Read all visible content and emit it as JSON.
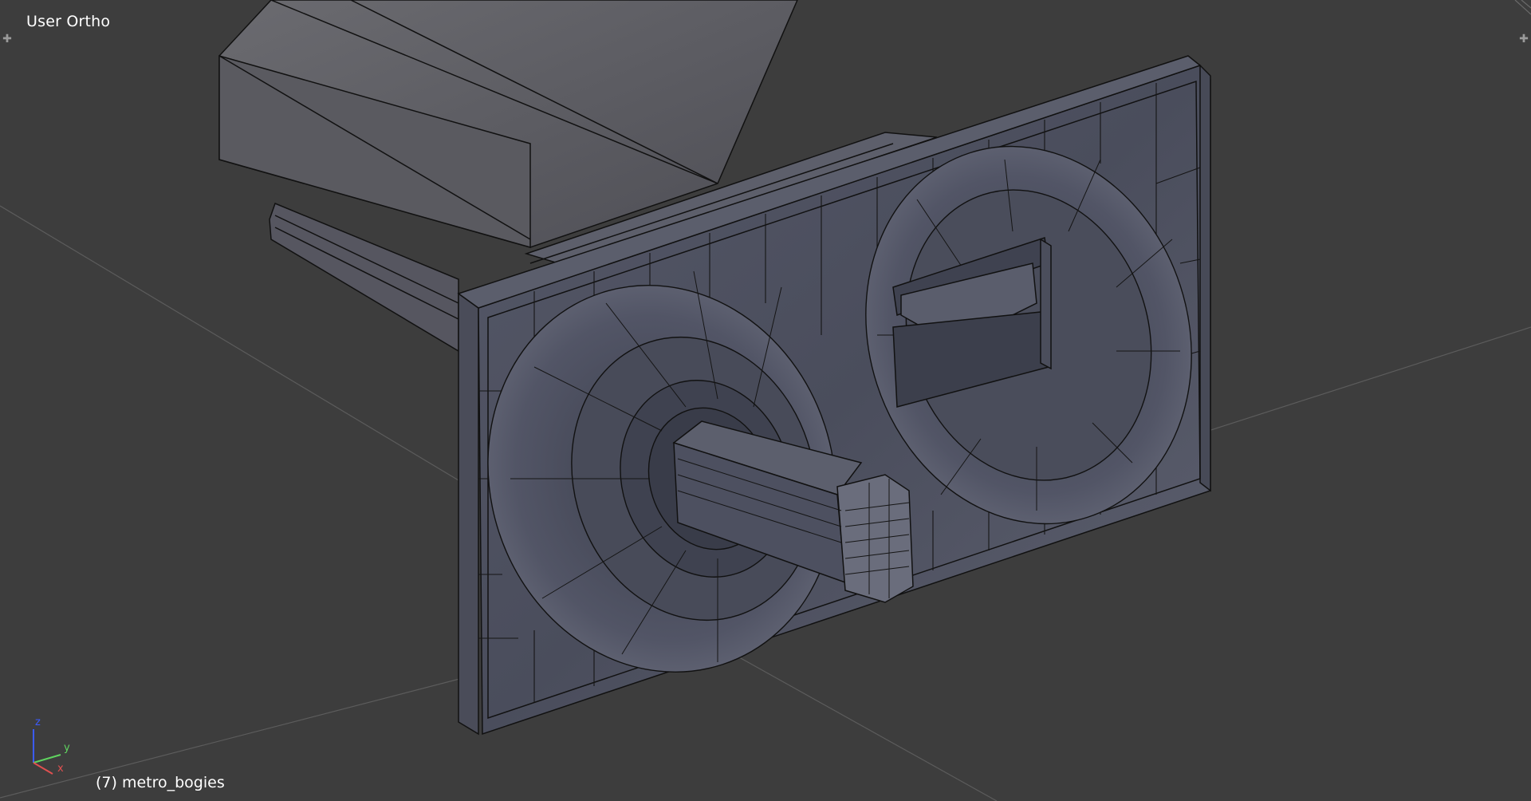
{
  "viewport": {
    "view_name": "User Ortho",
    "object_label": "(7) metro_bogies",
    "background_color": "#3d3d3d",
    "grid_color": "#5a5a5a",
    "mesh_face_color": "#4f5160",
    "mesh_wire_color": "#111111"
  },
  "corner_widgets": {
    "left_icon": "split-area-plus-icon",
    "left_glyph": "✚",
    "right_icon": "split-area-plus-icon",
    "right_glyph": "✚"
  },
  "axis_gizmo": {
    "z_label": "z",
    "y_label": "y",
    "x_label": "x",
    "z_color": "#3b5bff",
    "y_color": "#5fd35f",
    "x_color": "#e05050"
  }
}
